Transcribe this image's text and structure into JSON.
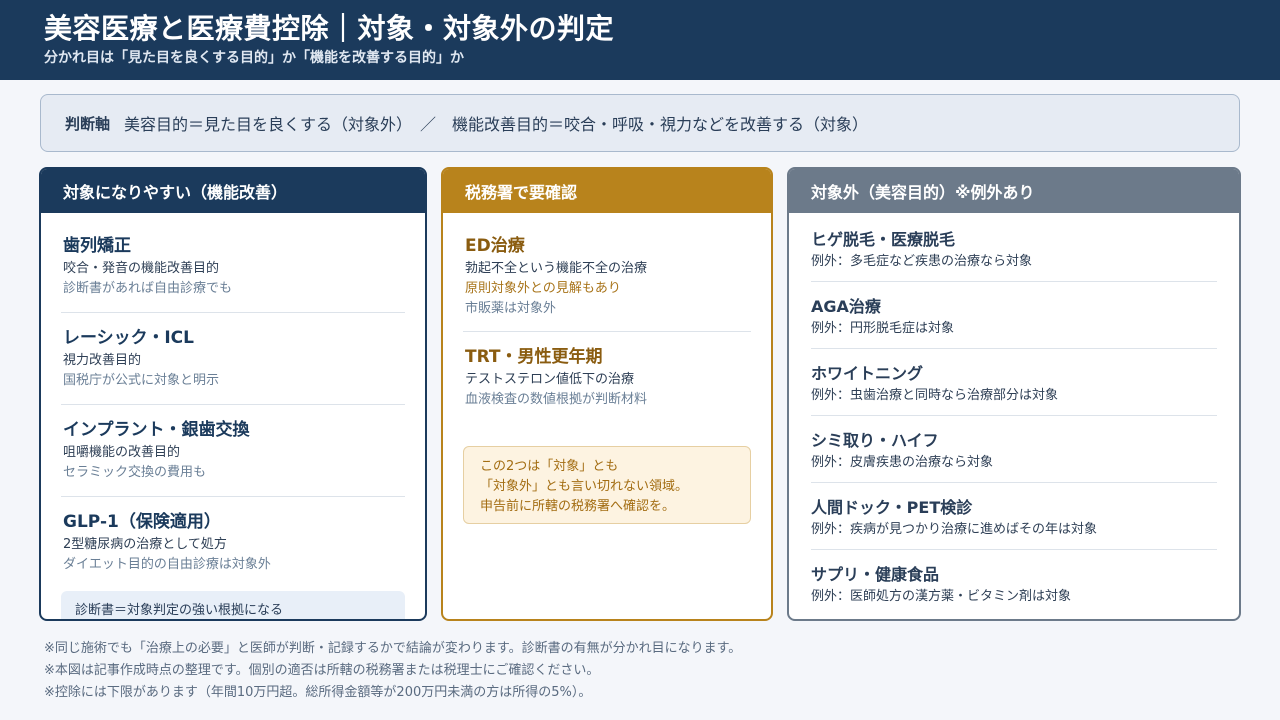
{
  "header": {
    "title": "美容医療と医療費控除｜対象・対象外の判定",
    "subtitle": "分かれ目は「見た目を良くする目的」か「機能を改善する目的」か"
  },
  "axis": {
    "label": "判断軸",
    "text": "美容目的＝見た目を良くする（対象外）　／　機能改善目的＝咬合・呼吸・視力などを改善する（対象）"
  },
  "left": {
    "heading": "対象になりやすい（機能改善）",
    "items": [
      {
        "title": "歯列矯正",
        "line1": "咬合・発音の機能改善目的",
        "line2": "診断書があれば自由診療でも"
      },
      {
        "title": "レーシック・ICL",
        "line1": "視力改善目的",
        "line2": "国税庁が公式に対象と明示"
      },
      {
        "title": "インプラント・銀歯交換",
        "line1": "咀嚼機能の改善目的",
        "line2": "セラミック交換の費用も"
      },
      {
        "title": "GLP-1（保険適用）",
        "line1": "2型糖尿病の治療として処方",
        "line2": "ダイエット目的の自由診療は対象外"
      }
    ],
    "note": "診断書＝対象判定の強い根拠になる"
  },
  "mid": {
    "heading": "税務署で要確認",
    "items": [
      {
        "title": "ED治療",
        "line1": "勃起不全という機能不全の治療",
        "warn": "原則対象外との見解もあり",
        "line2": "市販薬は対象外"
      },
      {
        "title": "TRT・男性更年期",
        "line1": "テストステロン値低下の治療",
        "line2": "血液検査の数値根拠が判断材料"
      }
    ],
    "callout": [
      "この2つは「対象」とも",
      "「対象外」とも言い切れない領域。",
      "申告前に所轄の税務署へ確認を。"
    ]
  },
  "right": {
    "heading": "対象外（美容目的）※例外あり",
    "items": [
      {
        "title": "ヒゲ脱毛・医療脱毛",
        "line1": "例外：多毛症など疾患の治療なら対象"
      },
      {
        "title": "AGA治療",
        "line1": "例外：円形脱毛症は対象"
      },
      {
        "title": "ホワイトニング",
        "line1": "例外：虫歯治療と同時なら治療部分は対象"
      },
      {
        "title": "シミ取り・ハイフ",
        "line1": "例外：皮膚疾患の治療なら対象"
      },
      {
        "title": "人間ドック・PET検診",
        "line1": "例外：疾病が見つかり治療に進めばその年は対象"
      },
      {
        "title": "サプリ・健康食品",
        "line1": "例外：医師処方の漢方薬・ビタミン剤は対象"
      }
    ]
  },
  "footer": [
    "※同じ施術でも「治療上の必要」と医師が判断・記録するかで結論が変わります。診断書の有無が分かれ目になります。",
    "※本図は記事作成時点の整理です。個別の適否は所轄の税務署または税理士にご確認ください。",
    "※控除には下限があります（年間10万円超。総所得金額等が200万円未満の方は所得の5%）。"
  ]
}
